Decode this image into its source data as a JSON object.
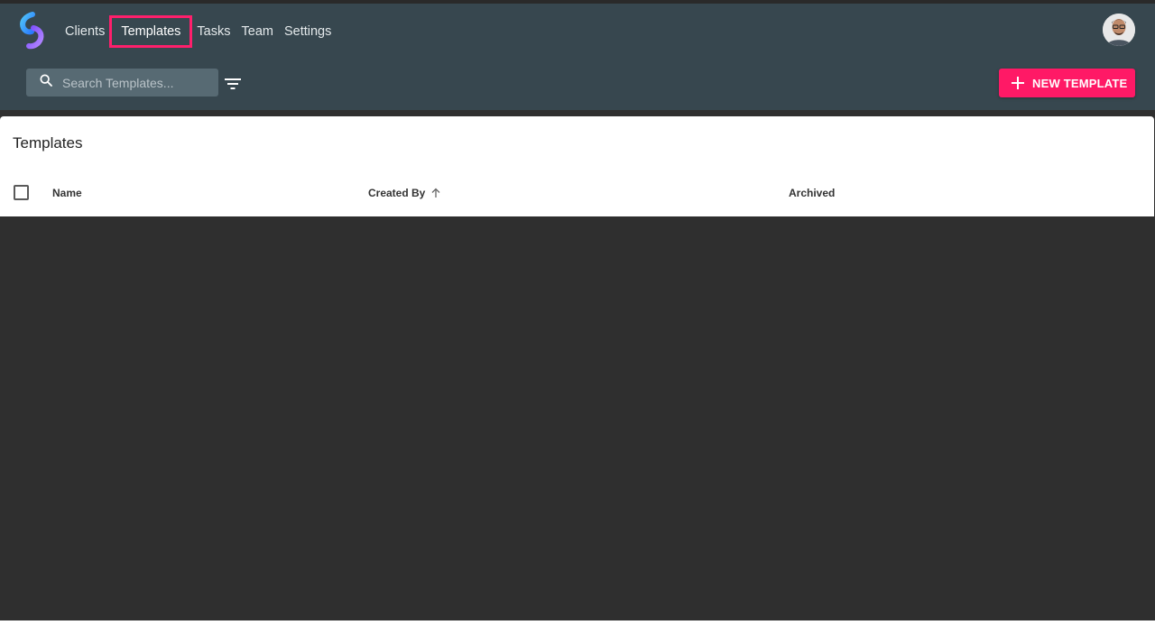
{
  "nav": {
    "items": [
      {
        "label": "Clients"
      },
      {
        "label": "Templates"
      },
      {
        "label": "Tasks"
      },
      {
        "label": "Team"
      },
      {
        "label": "Settings"
      }
    ],
    "active": "Templates"
  },
  "search": {
    "placeholder": "Search Templates..."
  },
  "toolbar": {
    "new_label": "NEW TEMPLATE"
  },
  "panel": {
    "title": "Templates",
    "columns": {
      "name": "Name",
      "created_by": "Created By",
      "archived": "Archived"
    }
  },
  "colors": {
    "header_bg": "#37474f",
    "accent": "#ff1966",
    "search_bg": "#576a73"
  },
  "icons": {
    "logo": "app-logo-icon",
    "search": "search-icon",
    "filter": "filter-icon",
    "plus": "plus-icon",
    "sort": "arrow-up-icon",
    "avatar": "user-avatar"
  }
}
